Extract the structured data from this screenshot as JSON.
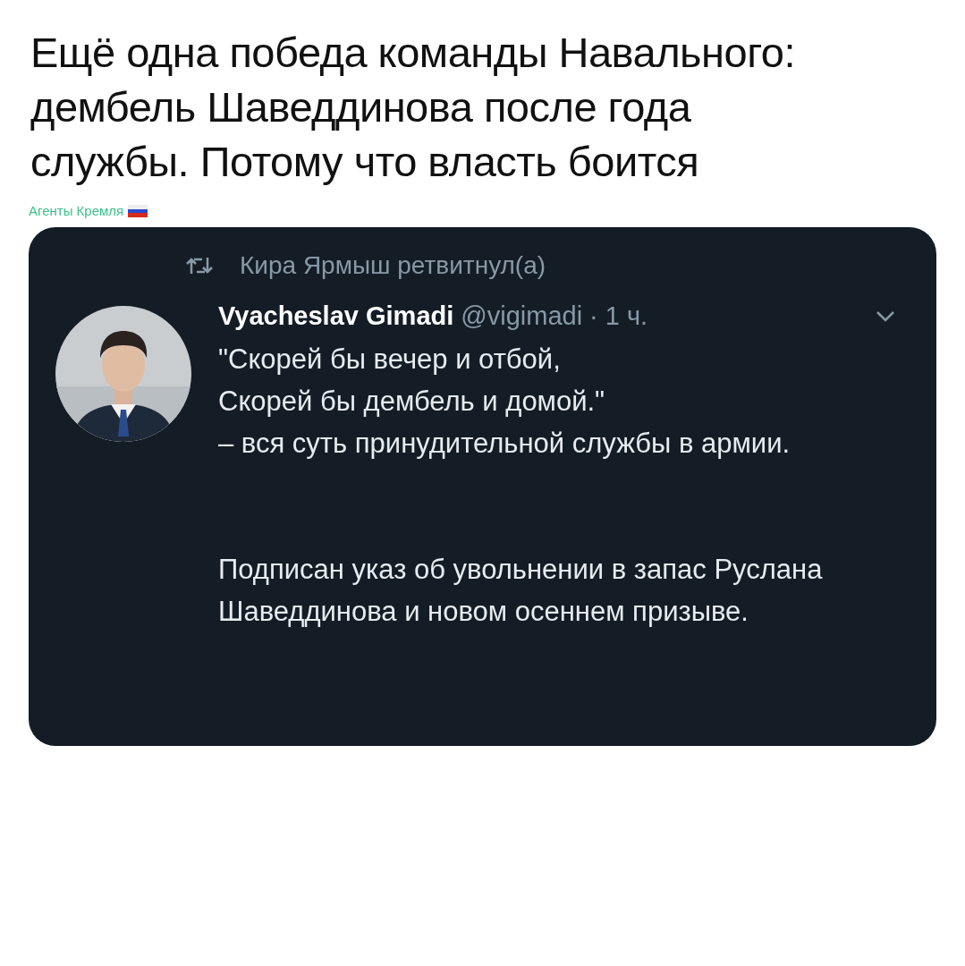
{
  "post": {
    "title": "Ещё одна победа команды Навального: дембель Шаведдинова после года службы. Потому что власть боится",
    "source_label": "Агенты Кремля"
  },
  "tweet": {
    "retweeted_by": "Кира Ярмыш ретвитнул(а)",
    "author_name": "Vyacheslav Gimadi",
    "handle": "@vigimadi",
    "time": "· 1 ч.",
    "text": "\"Скорей бы вечер и отбой,\nСкорей бы дембель и домой.\"\n– вся суть принудительной службы в армии.\n\n\nПодписан указ об увольнении в запас Руслана Шаведдинова и новом осеннем призыве."
  }
}
